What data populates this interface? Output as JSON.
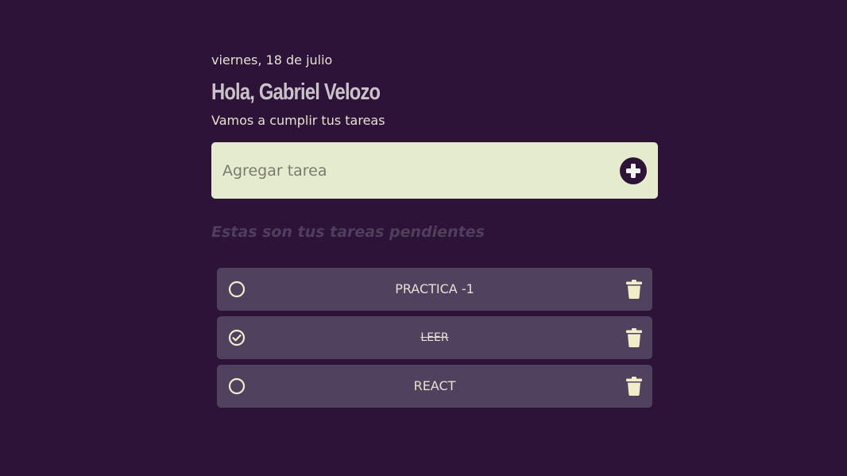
{
  "header": {
    "date": "viernes, 18 de julio",
    "greeting": "Hola, Gabriel Velozo",
    "subtitle": "Vamos a cumplir tus tareas"
  },
  "add_task": {
    "placeholder": "Agregar tarea",
    "value": "",
    "button_icon": "plus-circle-icon"
  },
  "section_title": "Estas son tus tareas pendientes",
  "tasks": [
    {
      "text": "PRACTICA -1",
      "completed": false
    },
    {
      "text": "LEER",
      "completed": true
    },
    {
      "text": "REACT",
      "completed": false
    }
  ],
  "icons": {
    "unchecked": "circle-icon",
    "checked": "check-circle-icon",
    "delete": "trash-icon"
  },
  "colors": {
    "background": "#2e1339",
    "card": "#50415e",
    "input_bg": "#e5ebcd",
    "text": "#e6e0d0",
    "accent_icon": "#f2edc9"
  }
}
